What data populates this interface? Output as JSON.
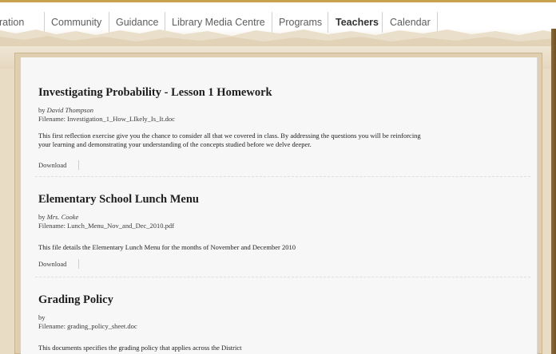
{
  "nav": {
    "items": [
      {
        "label": "ration"
      },
      {
        "label": "Community"
      },
      {
        "label": "Guidance"
      },
      {
        "label": "Library Media Centre"
      },
      {
        "label": "Programs"
      },
      {
        "label": "Teachers",
        "active": true
      },
      {
        "label": "Calendar"
      }
    ]
  },
  "documents": [
    {
      "title": "Investigating Probability - Lesson 1 Homework",
      "by": "by",
      "author": "David Thompson",
      "filename": "Filename: Investigation_1_How_LIkely_Is_It.doc",
      "description_line1": "This first reflection exercise give you the chance to consider all that we covered in class.  By addressing the questions you will be reinforcing",
      "description_line2": "your learning and demonstrating your understanding of the concepts studied before we delve deeper.",
      "download": "Download"
    },
    {
      "title": "Elementary School Lunch Menu",
      "by": "by",
      "author": "Mrs. Cooke",
      "filename": "Filename: Lunch_Menu_Nov_and_Dec_2010.pdf",
      "description_line1": "This file details the Elementary Lunch Menu for the months of November and December 2010",
      "download": "Download"
    },
    {
      "title": "Grading Policy",
      "by": "by",
      "author": "",
      "filename": "Filename: grading_policy_sheet.doc",
      "description_line1": "This documents specifies the grading policy that applies across the District"
    }
  ],
  "colors": {
    "accent": "#c8a24e",
    "page_background": "#f7f7f7",
    "paper": "#e8dcc4"
  }
}
